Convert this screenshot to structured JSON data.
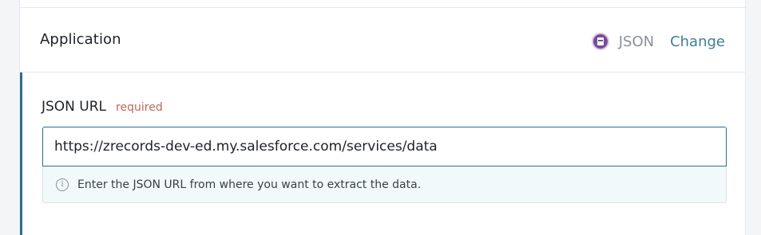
{
  "application": {
    "title": "Application",
    "connector_name": "JSON",
    "connector_icon": "json-logo-icon",
    "change_label": "Change"
  },
  "field": {
    "label": "JSON URL",
    "required_label": "required",
    "value": "https://zrecords-dev-ed.my.salesforce.com/services/data",
    "hint": "Enter the JSON URL from where you want to extract the data.",
    "hint_icon": "info-icon"
  },
  "colors": {
    "accent": "#2b6f8a",
    "link": "#3d7f98",
    "required": "#c0665c",
    "hint_background": "#f2f9fb"
  }
}
